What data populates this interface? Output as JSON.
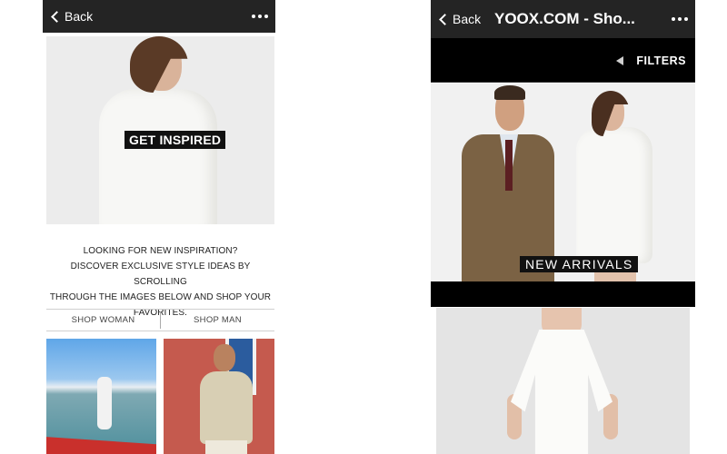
{
  "left_screen": {
    "topbar": {
      "back_label": "Back",
      "more_icon": "more-dots-icon"
    },
    "hero": {
      "banner_label": "GET INSPIRED"
    },
    "intro_lines": [
      "LOOKING FOR NEW INSPIRATION?",
      "DISCOVER EXCLUSIVE STYLE IDEAS BY SCROLLING",
      "THROUGH THE IMAGES BELOW AND SHOP YOUR",
      "FAVORITES."
    ],
    "tabs": [
      {
        "label": "SHOP WOMAN"
      },
      {
        "label": "SHOP MAN"
      }
    ]
  },
  "right_screen": {
    "topbar": {
      "back_label": "Back",
      "title": "YOOX.COM - Sho...",
      "more_icon": "more-dots-icon"
    },
    "filters": {
      "label": "FILTERS",
      "icon": "triangle-left-icon"
    },
    "hero": {
      "banner_label": "NEW ARRIVALS"
    }
  },
  "colors": {
    "topbar_bg": "#242424",
    "filters_bg": "#000000",
    "banner_bg": "#111111",
    "page_bg": "#ffffff"
  }
}
